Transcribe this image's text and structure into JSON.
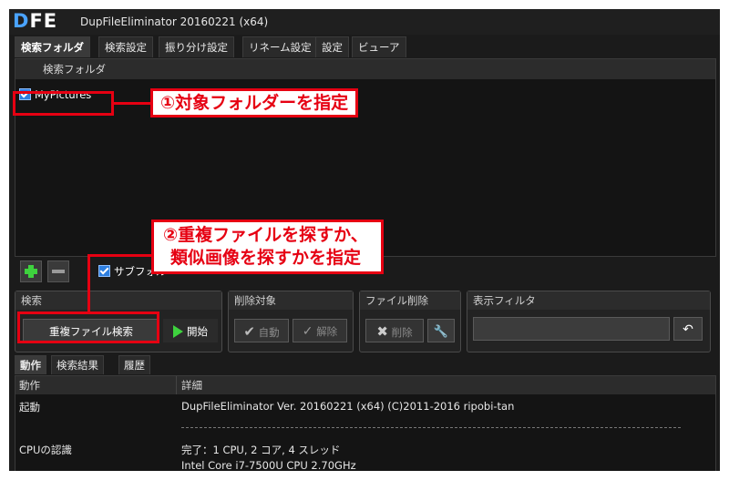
{
  "window": {
    "logo_d": "D",
    "logo_fe": "FE",
    "title": "DupFileEliminator 20160221 (x64)"
  },
  "tabs": [
    "検索フォルダ",
    "検索設定",
    "振り分け設定",
    "リネーム設定",
    "設定",
    "ビューア"
  ],
  "folder_panel": {
    "header": "検索フォルダ",
    "items": [
      {
        "label": "MyPictures",
        "checked": true
      }
    ]
  },
  "annotations": {
    "step1": "①対象フォルダーを指定",
    "step2_line1": "②重複ファイルを探すか、",
    "step2_line2": "類似画像を探すかを指定"
  },
  "toolbar": {
    "subfolder_label": "サブフォル"
  },
  "groups": {
    "search": {
      "title": "検索",
      "mode_button": "重複ファイル検索",
      "start_button": "開始"
    },
    "delete_target": {
      "title": "削除対象",
      "auto_button": "自動",
      "release_button": "解除"
    },
    "file_delete": {
      "title": "ファイル削除",
      "delete_button": "削除"
    },
    "display_filter": {
      "title": "表示フィルタ"
    }
  },
  "bottom_tabs": [
    "動作",
    "検索結果",
    "履歴"
  ],
  "log": {
    "columns": [
      "動作",
      "詳細"
    ],
    "rows": [
      {
        "action": "起動",
        "detail": "DupFileEliminator Ver. 20160221 (x64) (C)2011-2016 ripobi-tan"
      },
      {
        "action": "CPUの認識",
        "detail": "完了：1 CPU, 2 コア, 4 スレッド"
      },
      {
        "action": "",
        "detail": "Intel Core i7-7500U CPU 2.70GHz"
      }
    ]
  },
  "colors": {
    "annotation_red": "#e60012",
    "accent_green": "#3ed23e",
    "logo_blue": "#4aa3ff"
  }
}
